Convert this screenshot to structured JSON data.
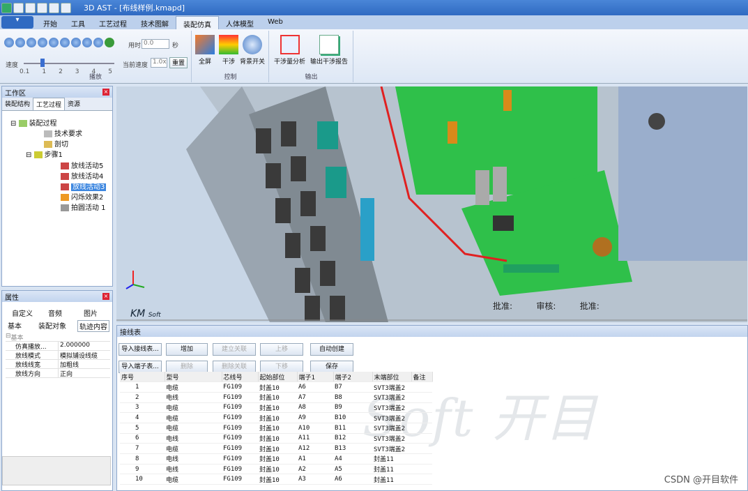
{
  "window": {
    "title": "3D AST - [布线样例.kmapd]"
  },
  "ribbon_tabs": [
    "开始",
    "工具",
    "工艺过程",
    "技术图解",
    "装配仿真",
    "人体模型",
    "Web"
  ],
  "playback": {
    "time_label": "用时",
    "time_value": "0.0",
    "time_unit": "秒",
    "speed_label": "速度",
    "current_speed_label": "当前速度",
    "current_speed_value": "1.0x",
    "reset": "重置",
    "ticks": [
      "0.1",
      "1",
      "2",
      "3",
      "4",
      "5"
    ],
    "group": "播放"
  },
  "control": {
    "fullscreen": "全屏",
    "interfere": "干涉",
    "bgm": "背景开关",
    "group": "控制"
  },
  "output": {
    "analysis": "干涉量分析",
    "report": "输出干涉报告",
    "group": "输出"
  },
  "workspace": {
    "title": "工作区",
    "tabs": [
      "装配结构",
      "工艺过程",
      "资源"
    ],
    "tree": [
      "装配过程",
      "技术要求",
      "剖切",
      "步骤1",
      "放线活动5",
      "放线活动4",
      "放线活动3",
      "闪烁效果2",
      "拍圆活动 1"
    ]
  },
  "properties": {
    "title": "属性",
    "tabs_row1": [
      "自定义",
      "音频",
      "图片"
    ],
    "tabs_row2": [
      "基本",
      "装配对象",
      "轨迹内容"
    ],
    "section": "基本",
    "rows": [
      [
        "仿真播放...",
        "2.000000"
      ],
      [
        "放线模式",
        "模拟铺设线缆"
      ],
      [
        "放线线宽",
        "加粗线"
      ],
      [
        "放线方向",
        "正向"
      ]
    ]
  },
  "viewport": {
    "stamp": [
      "批准:",
      "审核:",
      "批准:"
    ],
    "logo": "Soft"
  },
  "wiring": {
    "title": "接线表",
    "buttons_row1": [
      "导入接线表...",
      "增加",
      "建立关联",
      "上移",
      "自动创建"
    ],
    "buttons_row2": [
      "导入端子表...",
      "删除",
      "删除关联",
      "下移",
      "保存"
    ],
    "columns": [
      "序号",
      "型号",
      "芯线号",
      "起始部位",
      "端子1",
      "端子2",
      "末端部位",
      "备注"
    ],
    "rows": [
      [
        "1",
        "电缆",
        "FG109",
        "封盖10",
        "A6",
        "B7",
        "SVT3端盖2",
        ""
      ],
      [
        "2",
        "电线",
        "FG109",
        "封盖10",
        "A7",
        "B8",
        "SVT3端盖2",
        ""
      ],
      [
        "3",
        "电缆",
        "FG109",
        "封盖10",
        "A8",
        "B9",
        "SVT3端盖2",
        ""
      ],
      [
        "4",
        "电缆",
        "FG109",
        "封盖10",
        "A9",
        "B10",
        "SVT3端盖2",
        ""
      ],
      [
        "5",
        "电缆",
        "FG109",
        "封盖10",
        "A10",
        "B11",
        "SVT3端盖2",
        ""
      ],
      [
        "6",
        "电线",
        "FG109",
        "封盖10",
        "A11",
        "B12",
        "SVT3端盖2",
        ""
      ],
      [
        "7",
        "电缆",
        "FG109",
        "封盖10",
        "A12",
        "B13",
        "SVT3端盖2",
        ""
      ],
      [
        "8",
        "电线",
        "FG109",
        "封盖10",
        "A1",
        "A4",
        "封盖11",
        ""
      ],
      [
        "9",
        "电线",
        "FG109",
        "封盖10",
        "A2",
        "A5",
        "封盖11",
        ""
      ],
      [
        "10",
        "电缆",
        "FG109",
        "封盖10",
        "A3",
        "A6",
        "封盖11",
        ""
      ]
    ]
  },
  "watermark": {
    "text": "Soft 开目",
    "csdn": "CSDN @开目软件"
  }
}
